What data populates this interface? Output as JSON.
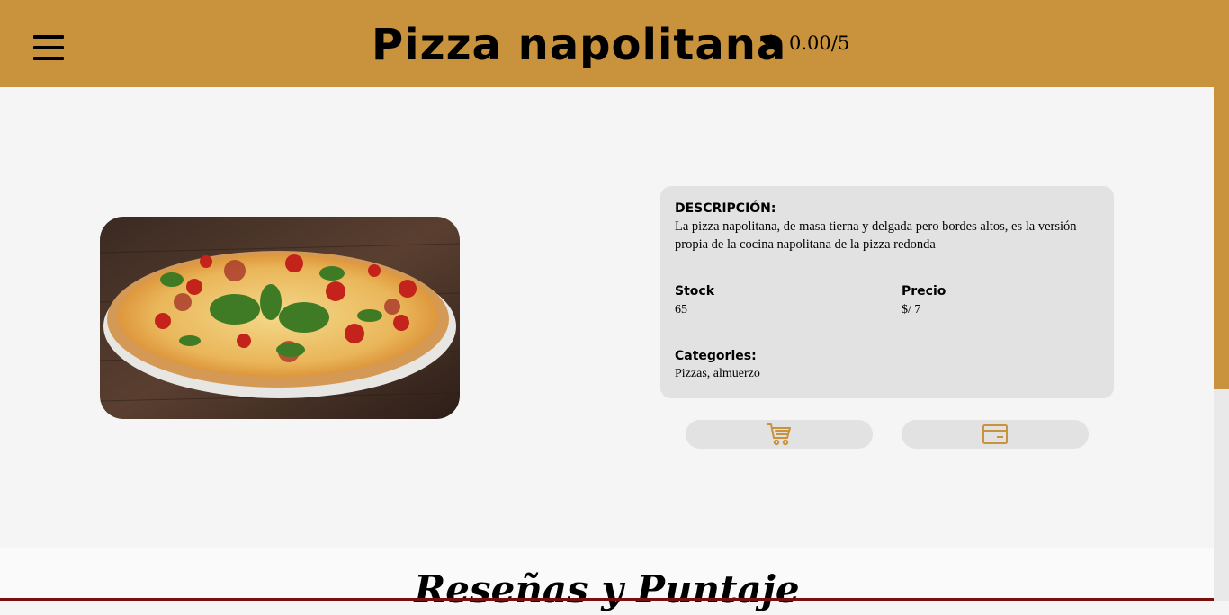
{
  "header": {
    "title": "Pizza napolitana",
    "rating": "0.00/5",
    "menu_icon": "hamburger-menu-icon",
    "star_icon": "star-icon"
  },
  "product": {
    "image_alt": "pizza-photo",
    "description_label": "DESCRIPCIÓN:",
    "description": "La pizza napolitana, de masa tierna y delgada pero bordes altos, es la versión propia de la cocina napolitana de la pizza redonda",
    "stock_label": "Stock",
    "stock": "65",
    "price_label": "Precio",
    "price": "$/ 7",
    "categories_label": "Categories:",
    "categories": "Pizzas, almuerzo"
  },
  "actions": {
    "cart_icon": "shopping-cart-icon",
    "card_icon": "credit-card-icon"
  },
  "reviews": {
    "title": "Reseñas y Puntaje"
  },
  "colors": {
    "brand": "#c9923d",
    "card_bg": "#e2e2e2",
    "page_bg": "#f5f5f5"
  }
}
